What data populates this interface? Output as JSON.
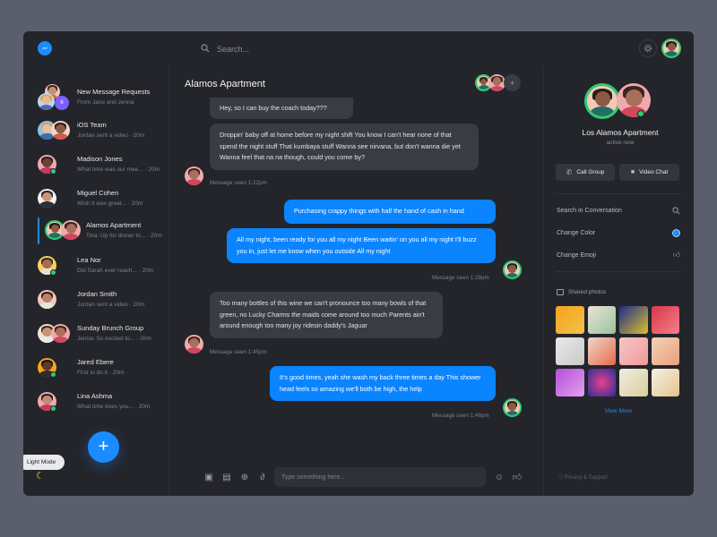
{
  "search": {
    "placeholder": "Search..."
  },
  "sidebar": {
    "items": [
      {
        "name": "New Message Requests",
        "sub": "From Jane and Jenna"
      },
      {
        "name": "iOS Team",
        "sub": "Jordan sent a video · 20m"
      },
      {
        "name": "Madison Jones",
        "sub": "What time was our mee... · 20m"
      },
      {
        "name": "Miguel Cohen",
        "sub": "Wish it was great... · 20m"
      },
      {
        "name": "Alamos Apartment",
        "sub": "Tina: Up for dinner to... · 20m"
      },
      {
        "name": "Lea Nor",
        "sub": "Did Sarah ever reach... · 20m"
      },
      {
        "name": "Jordan Smith",
        "sub": "Jordan sent a video · 20m"
      },
      {
        "name": "Sunday Brunch Group",
        "sub": "Jenna: So excited to... · 20m"
      },
      {
        "name": "Jared Ebere",
        "sub": "First to do it · 20m"
      },
      {
        "name": "Lina Ashma",
        "sub": "What time does you... · 20m"
      }
    ],
    "fab": "+",
    "light_mode": "Light Mode"
  },
  "chat": {
    "title": "Alamos Apartment",
    "messages": [
      {
        "text": "Hey, so I can buy the coach today???"
      },
      {
        "text": "Droppin' baby off at home before my night shift You know I can't hear none of that spend the night stuff That kumbaya stuff Wanna see nirvana, but don't wanna die yet Wanna feel that na na though, could you come by?"
      },
      {
        "text": "Purchasing crappy things with half the hand of cash in hand"
      },
      {
        "text": "All my night, been ready for you all my night Been waitin' on you all my night I'll buzz you in, just let me know when you outside All my night"
      },
      {
        "text": "Too many bottles of this wine we can't pronounce too many bowls of that green, no Lucky Charms the maids come around too much Parents ain't around enough too many joy ridesin daddy's Jaguar"
      },
      {
        "text": "It's good times, yeah she wash my back three times a day This shower head feels so amazing we'll both be high, the help"
      }
    ],
    "seen": [
      "Message seen 1:22pm",
      "Message seen 1:28pm",
      "Message seen 1:45pm",
      "Message seen 1:46pm"
    ],
    "input_placeholder": "Type something here..."
  },
  "panel": {
    "title": "Los Alamos Apartment",
    "status": "active now",
    "call_group": "Call Group",
    "video_chat": "Video Chat",
    "options": [
      "Search in Conversation",
      "Change Color",
      "Change Emoji"
    ],
    "shared_photos": "Shared photos",
    "view_more": "View More",
    "privacy": "Privacy & Support"
  },
  "colors": {
    "accent": "#1a8cff",
    "online": "#2ecc71",
    "bg": "#24252b",
    "bubble_in": "#3a3c43",
    "bubble_out": "#0a84ff"
  }
}
